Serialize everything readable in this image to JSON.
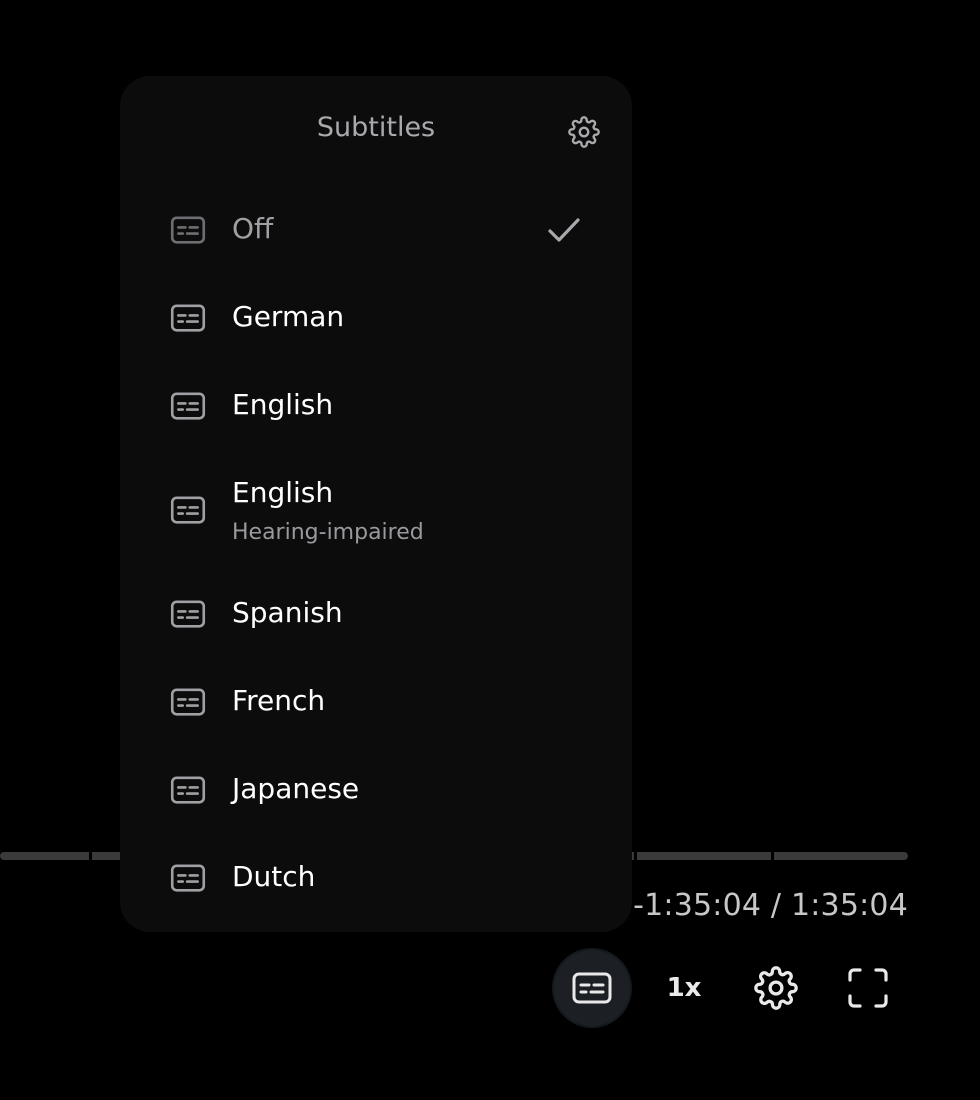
{
  "player": {
    "time_display": "-1:35:04 / 1:35:04",
    "speed_label": "1x",
    "colors": {
      "background": "#000000",
      "menu_background": "#0c0c0d",
      "track": "#3a3a3c",
      "active_button": "#1c1f24"
    }
  },
  "controls": {
    "subtitles_icon": "subtitles-icon",
    "settings_icon": "gear-icon",
    "fullscreen_icon": "fullscreen-icon"
  },
  "subtitles_menu": {
    "title": "Subtitles",
    "settings_icon": "gear-icon",
    "selected": "Off",
    "items": [
      {
        "label": "Off",
        "sublabel": "",
        "icon": "subtitles-icon",
        "selected": true
      },
      {
        "label": "German",
        "sublabel": "",
        "icon": "subtitles-icon",
        "selected": false
      },
      {
        "label": "English",
        "sublabel": "",
        "icon": "subtitles-icon",
        "selected": false
      },
      {
        "label": "English",
        "sublabel": "Hearing-impaired",
        "icon": "subtitles-icon",
        "selected": false
      },
      {
        "label": "Spanish",
        "sublabel": "",
        "icon": "subtitles-icon",
        "selected": false
      },
      {
        "label": "French",
        "sublabel": "",
        "icon": "subtitles-icon",
        "selected": false
      },
      {
        "label": "Japanese",
        "sublabel": "",
        "icon": "subtitles-icon",
        "selected": false
      },
      {
        "label": "Dutch",
        "sublabel": "",
        "icon": "subtitles-icon",
        "selected": false
      }
    ]
  }
}
